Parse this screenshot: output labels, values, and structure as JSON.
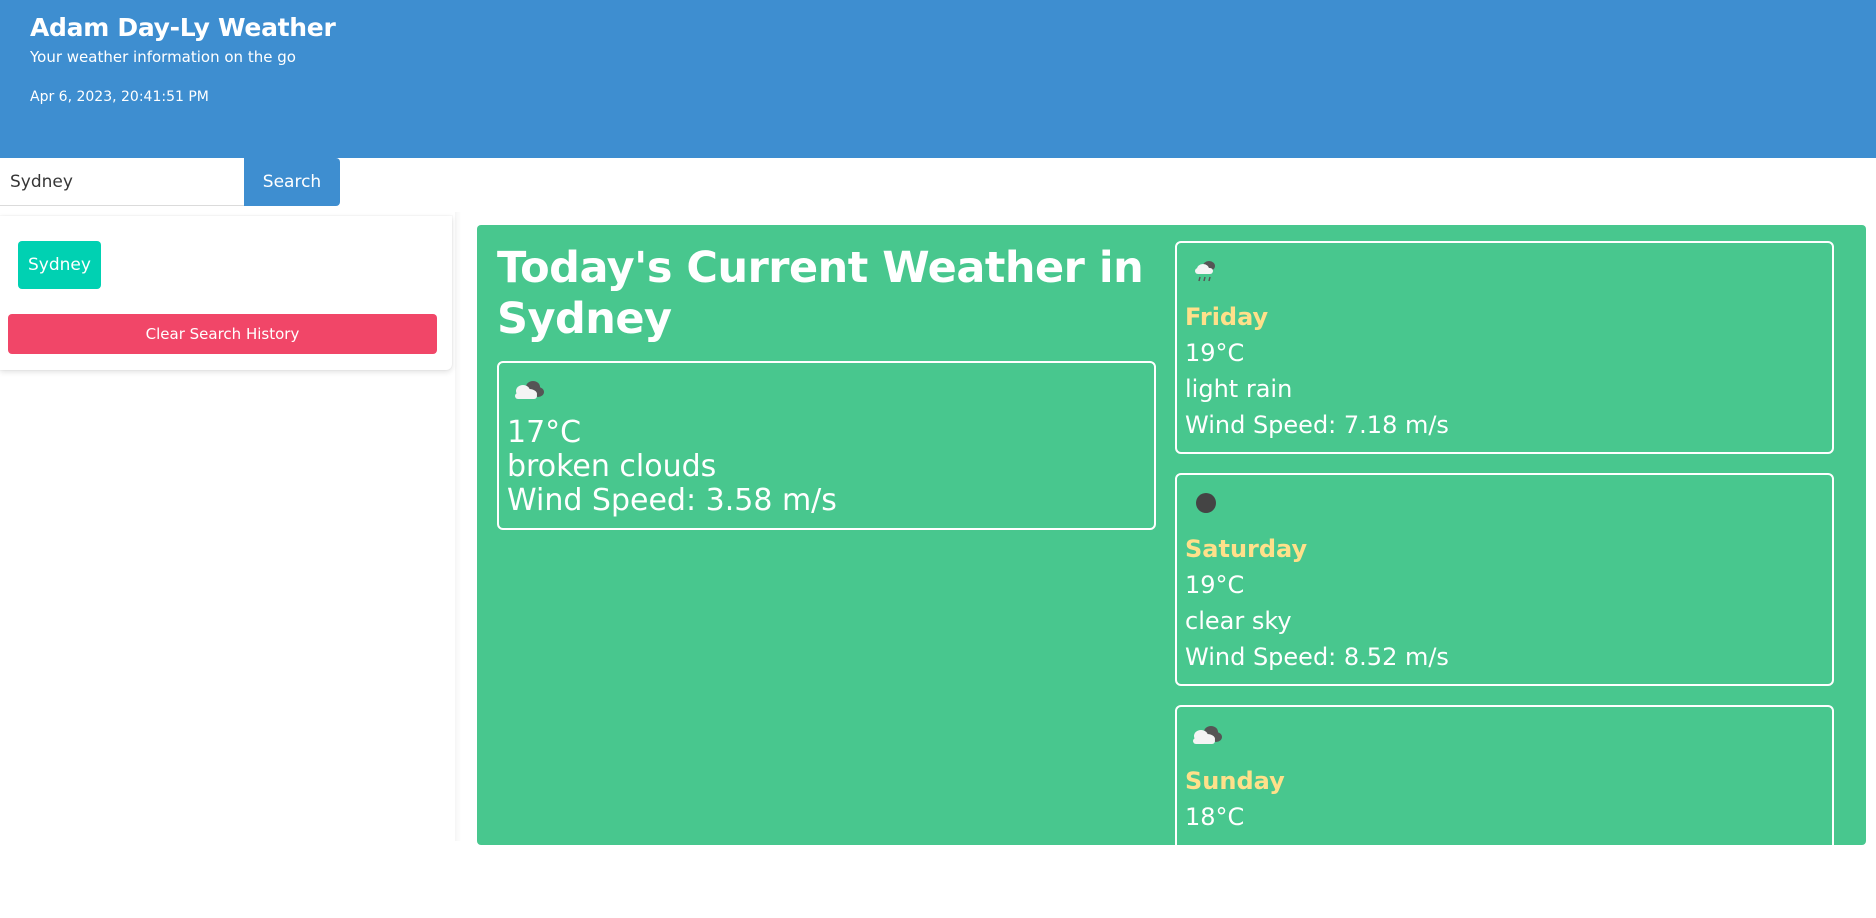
{
  "header": {
    "title": "Adam Day-Ly Weather",
    "subtitle": "Your weather information on the go",
    "datetime": "Apr 6, 2023, 20:41:51 PM"
  },
  "search": {
    "value": "Sydney",
    "button_label": "Search"
  },
  "history": {
    "items": [
      "Sydney"
    ],
    "clear_label": "Clear Search History"
  },
  "current": {
    "heading": "Today's Current Weather in Sydney",
    "icon": "broken-clouds-icon",
    "temperature": "17°C",
    "description": "broken clouds",
    "wind": "Wind Speed: 3.58 m/s"
  },
  "forecast": [
    {
      "day": "Friday",
      "icon": "light-rain-icon",
      "temperature": "19°C",
      "description": "light rain",
      "wind": "Wind Speed: 7.18 m/s"
    },
    {
      "day": "Saturday",
      "icon": "clear-sky-icon",
      "temperature": "19°C",
      "description": "clear sky",
      "wind": "Wind Speed: 8.52 m/s"
    },
    {
      "day": "Sunday",
      "icon": "broken-clouds-icon",
      "temperature": "18°C",
      "description": "",
      "wind": ""
    }
  ],
  "colors": {
    "header_blue": "#3e8ed0",
    "panel_green": "#48c78e",
    "history_teal": "#00d1b2",
    "clear_red": "#f14668",
    "day_yellow": "#ffe08a"
  }
}
